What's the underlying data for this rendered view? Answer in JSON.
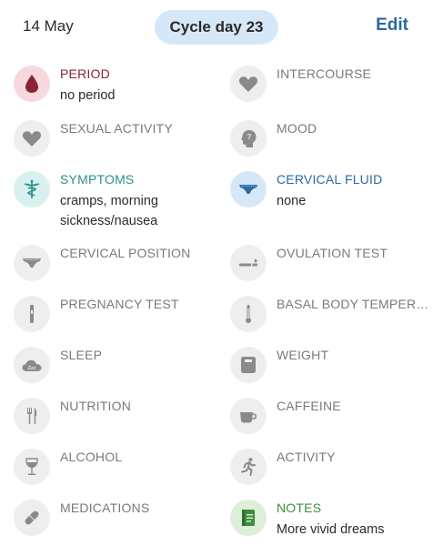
{
  "header": {
    "date": "14 May",
    "cycle_day": "Cycle day 23",
    "edit_label": "Edit"
  },
  "colors": {
    "accent_blue": "#2a6aa3",
    "pill_bg": "#d6e8f8",
    "period_red": "#8b2332",
    "symptoms_teal": "#2c8f8a",
    "notes_green": "#3e8e3e"
  },
  "items": {
    "period": {
      "label": "PERIOD",
      "value": "no period",
      "icon": "blood-drop-icon"
    },
    "intercourse": {
      "label": "INTERCOURSE",
      "icon": "heart-icon"
    },
    "sexual_activity": {
      "label": "SEXUAL ACTIVITY",
      "icon": "heart-icon"
    },
    "mood": {
      "label": "MOOD",
      "icon": "head-question-icon"
    },
    "symptoms": {
      "label": "SYMPTOMS",
      "value": "cramps, morning sickness/nausea",
      "icon": "caduceus-icon"
    },
    "cervical_fluid": {
      "label": "CERVICAL FLUID",
      "value": "none",
      "icon": "underwear-icon"
    },
    "cervical_position": {
      "label": "CERVICAL POSITION",
      "icon": "underwear-icon"
    },
    "ovulation_test": {
      "label": "OVULATION TEST",
      "icon": "test-strip-icon"
    },
    "pregnancy_test": {
      "label": "PREGNANCY TEST",
      "icon": "test-stick-icon"
    },
    "basal_body_temp": {
      "label": "BASAL BODY TEMPER…",
      "icon": "thermometer-icon"
    },
    "sleep": {
      "label": "SLEEP",
      "icon": "cloud-zzz-icon"
    },
    "weight": {
      "label": "WEIGHT",
      "icon": "scale-icon"
    },
    "nutrition": {
      "label": "NUTRITION",
      "icon": "fork-knife-icon"
    },
    "caffeine": {
      "label": "CAFFEINE",
      "icon": "cup-icon"
    },
    "alcohol": {
      "label": "ALCOHOL",
      "icon": "wine-glass-icon"
    },
    "activity": {
      "label": "ACTIVITY",
      "icon": "runner-icon"
    },
    "medications": {
      "label": "MEDICATIONS",
      "icon": "pill-icon"
    },
    "notes": {
      "label": "NOTES",
      "value": "More vivid dreams",
      "icon": "notepad-icon"
    }
  }
}
